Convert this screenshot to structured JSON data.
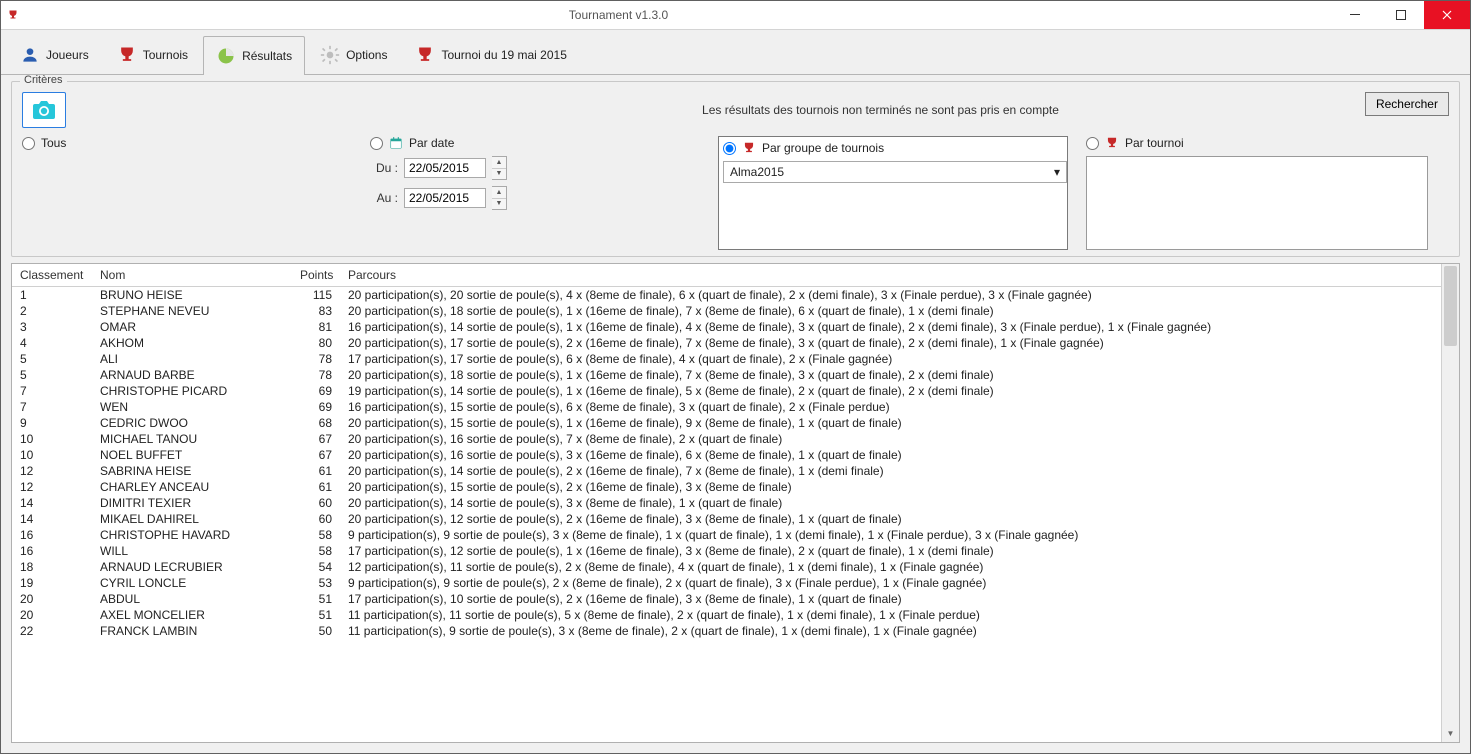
{
  "window": {
    "title": "Tournament v1.3.0"
  },
  "tabs": {
    "players": "Joueurs",
    "tournaments": "Tournois",
    "results": "Résultats",
    "options": "Options",
    "current": "Tournoi du 19 mai 2015"
  },
  "criteria": {
    "legend": "Critères",
    "info": "Les résultats des tournois non terminés ne sont pas pris en compte",
    "search": "Rechercher",
    "all": "Tous",
    "by_date": "Par date",
    "by_group": "Par groupe de tournois",
    "by_tournament": "Par tournoi",
    "date_from_label": "Du :",
    "date_to_label": "Au :",
    "date_from": "22/05/2015",
    "date_to": "22/05/2015",
    "group_selected": "Alma2015"
  },
  "columns": {
    "rank": "Classement",
    "name": "Nom",
    "points": "Points",
    "path": "Parcours"
  },
  "rows": [
    {
      "rank": "1",
      "name": "BRUNO HEISE",
      "points": "115",
      "path": "20 participation(s),  20 sortie de poule(s),  4 x (8eme de finale),  6 x (quart de finale),  2 x (demi finale),  3 x (Finale perdue),  3 x (Finale gagnée)"
    },
    {
      "rank": "2",
      "name": "STEPHANE NEVEU",
      "points": "83",
      "path": "20 participation(s),  18 sortie de poule(s),  1 x (16eme de finale),  7 x (8eme de finale),  6 x (quart de finale),  1 x (demi finale)"
    },
    {
      "rank": "3",
      "name": "OMAR",
      "points": "81",
      "path": "16 participation(s),  14 sortie de poule(s),  1 x (16eme de finale),  4 x (8eme de finale),  3 x (quart de finale),  2 x (demi finale),  3 x (Finale perdue),  1 x (Finale gagnée)"
    },
    {
      "rank": "4",
      "name": "AKHOM",
      "points": "80",
      "path": "20 participation(s),  17 sortie de poule(s),  2 x (16eme de finale),  7 x (8eme de finale),  3 x (quart de finale),  2 x (demi finale),  1 x (Finale gagnée)"
    },
    {
      "rank": "5",
      "name": "ALI",
      "points": "78",
      "path": "17 participation(s),  17 sortie de poule(s),  6 x (8eme de finale),  4 x (quart de finale),  2 x (Finale gagnée)"
    },
    {
      "rank": "5",
      "name": "ARNAUD BARBE",
      "points": "78",
      "path": "20 participation(s),  18 sortie de poule(s),  1 x (16eme de finale),  7 x (8eme de finale),  3 x (quart de finale),  2 x (demi finale)"
    },
    {
      "rank": "7",
      "name": "CHRISTOPHE PICARD",
      "points": "69",
      "path": "19 participation(s),  14 sortie de poule(s),  1 x (16eme de finale),  5 x (8eme de finale),  2 x (quart de finale),  2 x (demi finale)"
    },
    {
      "rank": "7",
      "name": "WEN",
      "points": "69",
      "path": "16 participation(s),  15 sortie de poule(s),  6 x (8eme de finale),  3 x (quart de finale),  2 x (Finale perdue)"
    },
    {
      "rank": "9",
      "name": "CEDRIC DWOO",
      "points": "68",
      "path": "20 participation(s),  15 sortie de poule(s),  1 x (16eme de finale),  9 x (8eme de finale),  1 x (quart de finale)"
    },
    {
      "rank": "10",
      "name": "MICHAEL TANOU",
      "points": "67",
      "path": "20 participation(s),  16 sortie de poule(s),  7 x (8eme de finale),  2 x (quart de finale)"
    },
    {
      "rank": "10",
      "name": "NOEL BUFFET",
      "points": "67",
      "path": "20 participation(s),  16 sortie de poule(s),  3 x (16eme de finale),  6 x (8eme de finale),  1 x (quart de finale)"
    },
    {
      "rank": "12",
      "name": "SABRINA HEISE",
      "points": "61",
      "path": "20 participation(s),  14 sortie de poule(s),  2 x (16eme de finale),  7 x (8eme de finale),  1 x (demi finale)"
    },
    {
      "rank": "12",
      "name": "CHARLEY ANCEAU",
      "points": "61",
      "path": "20 participation(s),  15 sortie de poule(s),  2 x (16eme de finale),  3 x (8eme de finale)"
    },
    {
      "rank": "14",
      "name": "DIMITRI TEXIER",
      "points": "60",
      "path": "20 participation(s),  14 sortie de poule(s),  3 x (8eme de finale),  1 x (quart de finale)"
    },
    {
      "rank": "14",
      "name": "MIKAEL DAHIREL",
      "points": "60",
      "path": "20 participation(s),  12 sortie de poule(s),  2 x (16eme de finale),  3 x (8eme de finale),  1 x (quart de finale)"
    },
    {
      "rank": "16",
      "name": "CHRISTOPHE HAVARD",
      "points": "58",
      "path": "9 participation(s),  9 sortie de poule(s),  3 x (8eme de finale),  1 x (quart de finale),  1 x (demi finale),  1 x (Finale perdue),  3 x (Finale gagnée)"
    },
    {
      "rank": "16",
      "name": "WILL",
      "points": "58",
      "path": "17 participation(s),  12 sortie de poule(s),  1 x (16eme de finale),  3 x (8eme de finale),  2 x (quart de finale),  1 x (demi finale)"
    },
    {
      "rank": "18",
      "name": "ARNAUD LECRUBIER",
      "points": "54",
      "path": "12 participation(s),  11 sortie de poule(s),  2 x (8eme de finale),  4 x (quart de finale),  1 x (demi finale),  1 x (Finale gagnée)"
    },
    {
      "rank": "19",
      "name": "CYRIL LONCLE",
      "points": "53",
      "path": "9 participation(s),  9 sortie de poule(s),  2 x (8eme de finale),  2 x (quart de finale),  3 x (Finale perdue),  1 x (Finale gagnée)"
    },
    {
      "rank": "20",
      "name": "ABDUL",
      "points": "51",
      "path": "17 participation(s),  10 sortie de poule(s),  2 x (16eme de finale),  3 x (8eme de finale),  1 x (quart de finale)"
    },
    {
      "rank": "20",
      "name": "AXEL MONCELIER",
      "points": "51",
      "path": "11 participation(s),  11 sortie de poule(s),  5 x (8eme de finale),  2 x (quart de finale),  1 x (demi finale),  1 x (Finale perdue)"
    },
    {
      "rank": "22",
      "name": "FRANCK LAMBIN",
      "points": "50",
      "path": "11 participation(s),  9 sortie de poule(s),  3 x (8eme de finale),  2 x (quart de finale),  1 x (demi finale),  1 x (Finale gagnée)"
    }
  ]
}
